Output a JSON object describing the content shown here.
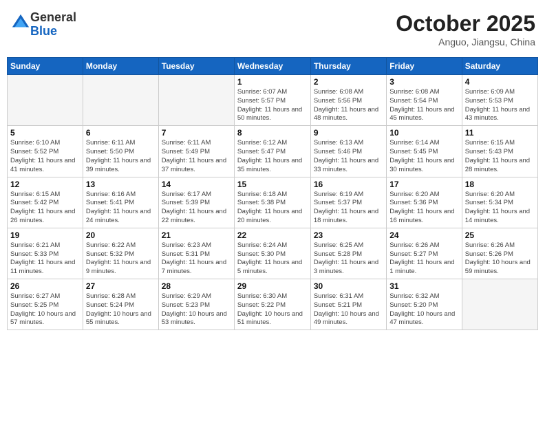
{
  "header": {
    "logo_general": "General",
    "logo_blue": "Blue",
    "month": "October 2025",
    "location": "Anguo, Jiangsu, China"
  },
  "days_of_week": [
    "Sunday",
    "Monday",
    "Tuesday",
    "Wednesday",
    "Thursday",
    "Friday",
    "Saturday"
  ],
  "weeks": [
    [
      {
        "day": "",
        "info": ""
      },
      {
        "day": "",
        "info": ""
      },
      {
        "day": "",
        "info": ""
      },
      {
        "day": "1",
        "info": "Sunrise: 6:07 AM\nSunset: 5:57 PM\nDaylight: 11 hours\nand 50 minutes."
      },
      {
        "day": "2",
        "info": "Sunrise: 6:08 AM\nSunset: 5:56 PM\nDaylight: 11 hours\nand 48 minutes."
      },
      {
        "day": "3",
        "info": "Sunrise: 6:08 AM\nSunset: 5:54 PM\nDaylight: 11 hours\nand 45 minutes."
      },
      {
        "day": "4",
        "info": "Sunrise: 6:09 AM\nSunset: 5:53 PM\nDaylight: 11 hours\nand 43 minutes."
      }
    ],
    [
      {
        "day": "5",
        "info": "Sunrise: 6:10 AM\nSunset: 5:52 PM\nDaylight: 11 hours\nand 41 minutes."
      },
      {
        "day": "6",
        "info": "Sunrise: 6:11 AM\nSunset: 5:50 PM\nDaylight: 11 hours\nand 39 minutes."
      },
      {
        "day": "7",
        "info": "Sunrise: 6:11 AM\nSunset: 5:49 PM\nDaylight: 11 hours\nand 37 minutes."
      },
      {
        "day": "8",
        "info": "Sunrise: 6:12 AM\nSunset: 5:47 PM\nDaylight: 11 hours\nand 35 minutes."
      },
      {
        "day": "9",
        "info": "Sunrise: 6:13 AM\nSunset: 5:46 PM\nDaylight: 11 hours\nand 33 minutes."
      },
      {
        "day": "10",
        "info": "Sunrise: 6:14 AM\nSunset: 5:45 PM\nDaylight: 11 hours\nand 30 minutes."
      },
      {
        "day": "11",
        "info": "Sunrise: 6:15 AM\nSunset: 5:43 PM\nDaylight: 11 hours\nand 28 minutes."
      }
    ],
    [
      {
        "day": "12",
        "info": "Sunrise: 6:15 AM\nSunset: 5:42 PM\nDaylight: 11 hours\nand 26 minutes."
      },
      {
        "day": "13",
        "info": "Sunrise: 6:16 AM\nSunset: 5:41 PM\nDaylight: 11 hours\nand 24 minutes."
      },
      {
        "day": "14",
        "info": "Sunrise: 6:17 AM\nSunset: 5:39 PM\nDaylight: 11 hours\nand 22 minutes."
      },
      {
        "day": "15",
        "info": "Sunrise: 6:18 AM\nSunset: 5:38 PM\nDaylight: 11 hours\nand 20 minutes."
      },
      {
        "day": "16",
        "info": "Sunrise: 6:19 AM\nSunset: 5:37 PM\nDaylight: 11 hours\nand 18 minutes."
      },
      {
        "day": "17",
        "info": "Sunrise: 6:20 AM\nSunset: 5:36 PM\nDaylight: 11 hours\nand 16 minutes."
      },
      {
        "day": "18",
        "info": "Sunrise: 6:20 AM\nSunset: 5:34 PM\nDaylight: 11 hours\nand 14 minutes."
      }
    ],
    [
      {
        "day": "19",
        "info": "Sunrise: 6:21 AM\nSunset: 5:33 PM\nDaylight: 11 hours\nand 11 minutes."
      },
      {
        "day": "20",
        "info": "Sunrise: 6:22 AM\nSunset: 5:32 PM\nDaylight: 11 hours\nand 9 minutes."
      },
      {
        "day": "21",
        "info": "Sunrise: 6:23 AM\nSunset: 5:31 PM\nDaylight: 11 hours\nand 7 minutes."
      },
      {
        "day": "22",
        "info": "Sunrise: 6:24 AM\nSunset: 5:30 PM\nDaylight: 11 hours\nand 5 minutes."
      },
      {
        "day": "23",
        "info": "Sunrise: 6:25 AM\nSunset: 5:28 PM\nDaylight: 11 hours\nand 3 minutes."
      },
      {
        "day": "24",
        "info": "Sunrise: 6:26 AM\nSunset: 5:27 PM\nDaylight: 11 hours\nand 1 minute."
      },
      {
        "day": "25",
        "info": "Sunrise: 6:26 AM\nSunset: 5:26 PM\nDaylight: 10 hours\nand 59 minutes."
      }
    ],
    [
      {
        "day": "26",
        "info": "Sunrise: 6:27 AM\nSunset: 5:25 PM\nDaylight: 10 hours\nand 57 minutes."
      },
      {
        "day": "27",
        "info": "Sunrise: 6:28 AM\nSunset: 5:24 PM\nDaylight: 10 hours\nand 55 minutes."
      },
      {
        "day": "28",
        "info": "Sunrise: 6:29 AM\nSunset: 5:23 PM\nDaylight: 10 hours\nand 53 minutes."
      },
      {
        "day": "29",
        "info": "Sunrise: 6:30 AM\nSunset: 5:22 PM\nDaylight: 10 hours\nand 51 minutes."
      },
      {
        "day": "30",
        "info": "Sunrise: 6:31 AM\nSunset: 5:21 PM\nDaylight: 10 hours\nand 49 minutes."
      },
      {
        "day": "31",
        "info": "Sunrise: 6:32 AM\nSunset: 5:20 PM\nDaylight: 10 hours\nand 47 minutes."
      },
      {
        "day": "",
        "info": ""
      }
    ]
  ]
}
